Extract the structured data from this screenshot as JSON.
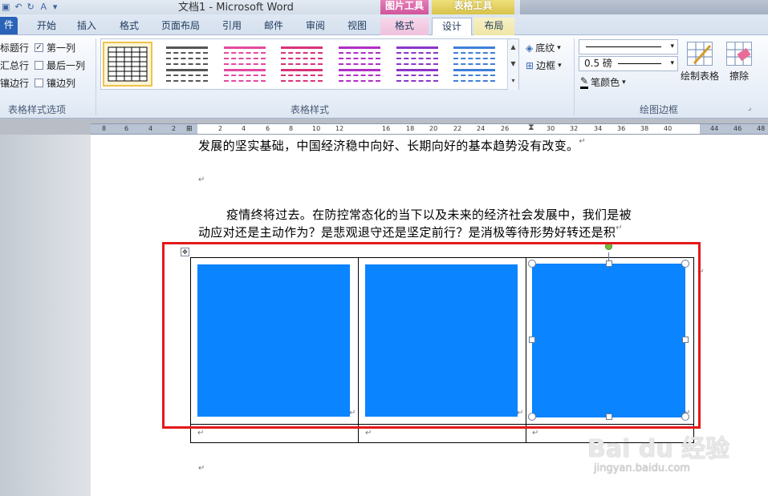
{
  "titlebar": {
    "doc_title": "文档1 - Microsoft Word",
    "contextual_picture": "图片工具",
    "contextual_table": "表格工具"
  },
  "tabs": [
    {
      "label": "件"
    },
    {
      "label": "开始"
    },
    {
      "label": "插入"
    },
    {
      "label": "格式"
    },
    {
      "label": "页面布局"
    },
    {
      "label": "引用"
    },
    {
      "label": "邮件"
    },
    {
      "label": "审阅"
    },
    {
      "label": "视图"
    },
    {
      "label": "格式"
    },
    {
      "label": "设计"
    },
    {
      "label": "布局"
    }
  ],
  "style_options": {
    "title_row": "标题行",
    "total_row": "汇总行",
    "banded_rows": "镶边行",
    "first_column": "第一列",
    "last_column": "最后一列",
    "banded_columns": "镶边列",
    "first_column_checked": true,
    "group_label": "表格样式选项"
  },
  "table_styles": {
    "group_label": "表格样式",
    "swatch_colors": [
      "#333333",
      "#555555",
      "#e24aa0",
      "#d6337a",
      "#b02fc5",
      "#8b35c8",
      "#3f7fd9"
    ]
  },
  "shading": {
    "shading_label": "底纹",
    "borders_label": "边框"
  },
  "draw_borders": {
    "line_weight": "0.5 磅",
    "pen_color": "笔颜色",
    "draw_table": "绘制表格",
    "eraser": "擦除",
    "group_label": "绘图边框"
  },
  "ruler": {
    "left_numbers": [
      "8",
      "6",
      "4",
      "2"
    ],
    "right_numbers": [
      "2",
      "4",
      "6",
      "8",
      "10",
      "12",
      "16",
      "18",
      "20",
      "22",
      "24",
      "26",
      "30",
      "32",
      "34",
      "36",
      "38",
      "40",
      "44",
      "46",
      "48"
    ]
  },
  "document": {
    "line1": "发展的坚实基础，中国经济稳中向好、长期向好的基本趋势没有改变。",
    "para2_line1": "疫情终将过去。在防控常态化的当下以及未来的经济社会发展中，我们是被",
    "para2_line2": "动应对还是主动作为？是悲观退守还是坚定前行？是消极等待形势好转还是积",
    "para_mark": "↵",
    "image_color": "#0a84ff"
  },
  "watermark": {
    "logo": "Bai du 经验",
    "url": "jingyan.baidu.com"
  }
}
